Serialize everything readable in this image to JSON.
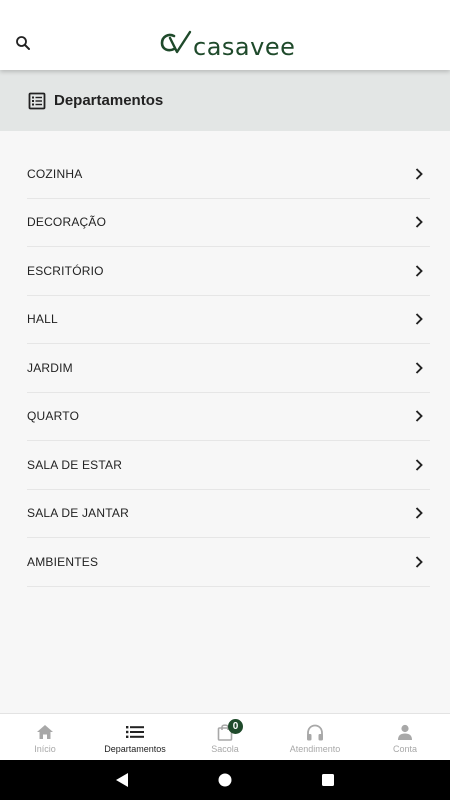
{
  "header": {
    "logo_monogram": "CV",
    "logo_text": "casavee",
    "brand_color": "#1f4a2b",
    "search_icon": "search-icon"
  },
  "departments_bar": {
    "title": "Departamentos",
    "icon": "list-alt-icon",
    "background": "#e3e6e5"
  },
  "departments": [
    {
      "label": "COZINHA"
    },
    {
      "label": "DECORAÇÃO"
    },
    {
      "label": "ESCRITÓRIO"
    },
    {
      "label": "HALL"
    },
    {
      "label": "JARDIM"
    },
    {
      "label": "QUARTO"
    },
    {
      "label": "SALA DE ESTAR"
    },
    {
      "label": "SALA DE JANTAR"
    },
    {
      "label": "AMBIENTES"
    }
  ],
  "bottom_nav": {
    "items": [
      {
        "label": "Início",
        "icon": "home-icon"
      },
      {
        "label": "Departamentos",
        "icon": "list-icon",
        "active": true
      },
      {
        "label": "Sacola",
        "icon": "shopping-bag-icon",
        "badge": "0"
      },
      {
        "label": "Atendimento",
        "icon": "headphones-icon"
      },
      {
        "label": "Conta",
        "icon": "person-icon"
      }
    ]
  },
  "system_nav": {
    "back": "back-triangle-icon",
    "home": "home-circle-icon",
    "recents": "recents-square-icon"
  }
}
